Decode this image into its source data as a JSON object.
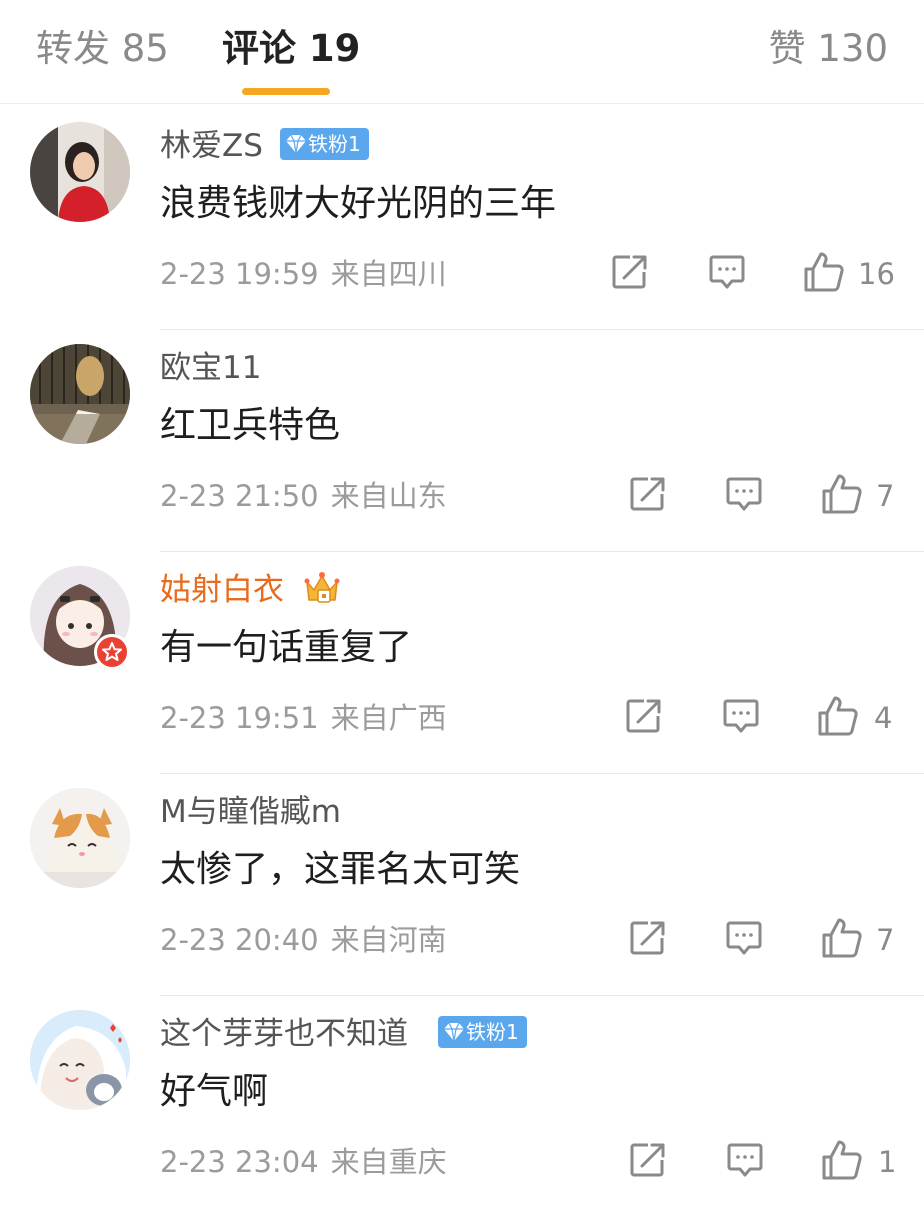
{
  "tabs": {
    "repost": "转发 85",
    "comments": "评论 19",
    "likes": "赞 130"
  },
  "colors": {
    "accent": "#f5a623",
    "vip_name": "#e86a1c",
    "fan_badge": "#5aa7ee"
  },
  "comments": [
    {
      "username": "林爱ZS",
      "badge": "铁粉1",
      "text": "浪费钱财大好光阴的三年",
      "time": "2-23 19:59",
      "location": "来自四川",
      "likes": "16"
    },
    {
      "username": "欧宝11",
      "text": "红卫兵特色",
      "time": "2-23 21:50",
      "location": "来自山东",
      "likes": "7"
    },
    {
      "username": "姑射白衣",
      "crown": "crown-icon",
      "text": "有一句话重复了",
      "time": "2-23 19:51",
      "location": "来自广西",
      "likes": "4"
    },
    {
      "username": "M与瞳偕臧m",
      "text": "太惨了，这罪名太可笑",
      "time": "2-23 20:40",
      "location": "来自河南",
      "likes": "7"
    },
    {
      "username": "这个芽芽也不知道",
      "badge": "铁粉1",
      "text": "好气啊",
      "time": "2-23 23:04",
      "location": "来自重庆",
      "likes": "1"
    }
  ],
  "icons": {
    "forward": "forward-icon",
    "reply": "comment-icon",
    "like": "thumbs-up-icon",
    "badge": "diamond-icon"
  }
}
